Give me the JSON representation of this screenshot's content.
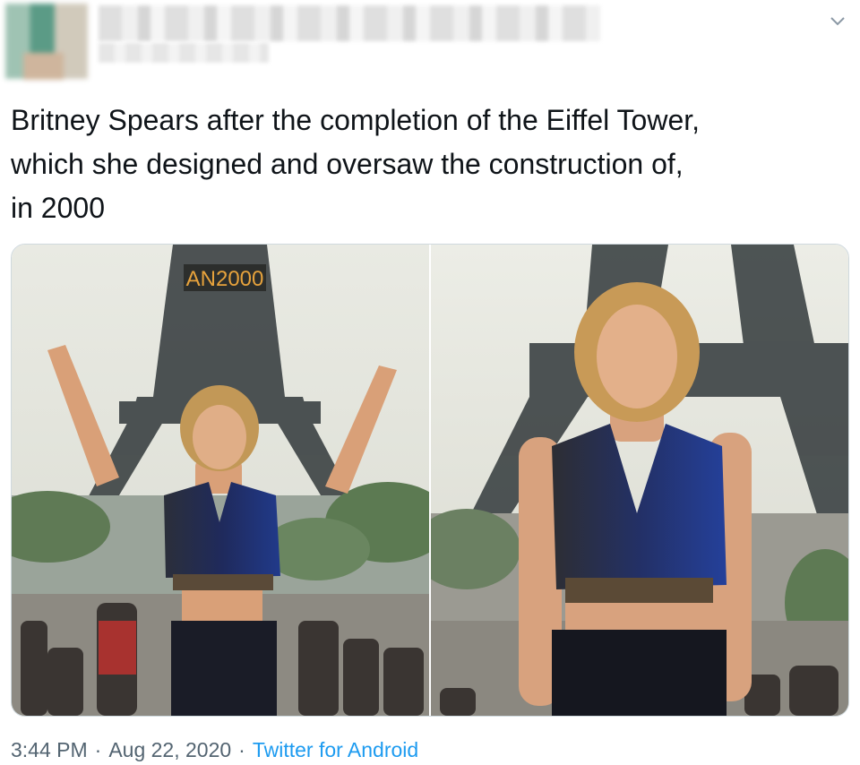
{
  "tweet": {
    "text": "Britney Spears after the completion of the Eiffel Tower,\nwhich she designed and oversaw the construction of,\nin 2000",
    "time": "3:44 PM",
    "separator": "·",
    "date": "Aug 22, 2020",
    "source": "Twitter for Android"
  },
  "media": {
    "left_photo": {
      "sign_text": "AN2000"
    }
  },
  "icons": {
    "menu": "chevron-down-icon"
  },
  "colors": {
    "link": "#1d9bf0",
    "meta": "#536471",
    "text": "#0f1419",
    "border": "#cfd9de"
  }
}
